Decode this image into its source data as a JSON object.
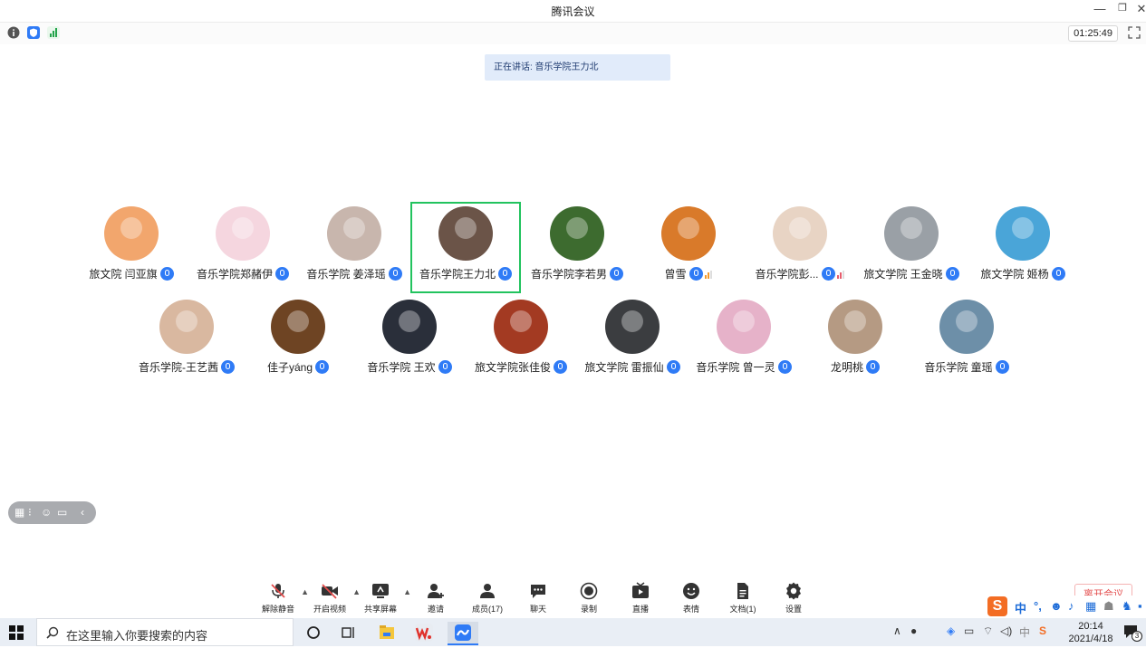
{
  "window": {
    "title": "腾讯会议"
  },
  "status": {
    "timer": "01:25:49"
  },
  "speaking": {
    "text": "正在讲话: 音乐学院王力北"
  },
  "participants": [
    {
      "name": "旅文院 闫亚旗",
      "bg": "#f2a66d"
    },
    {
      "name": "音乐学院郑赭伊",
      "bg": "#f5d6df"
    },
    {
      "name": "音乐学院 姜泽瑶",
      "bg": "#c8b6ad"
    },
    {
      "name": "音乐学院王力北",
      "bg": "#6b5448"
    },
    {
      "name": "音乐学院李若男",
      "bg": "#3d6b2f"
    },
    {
      "name": "曾雪",
      "bg": "#d97a2a"
    },
    {
      "name": "音乐学院彭...",
      "bg": "#e8d4c4"
    },
    {
      "name": "旅文学院 王金晓",
      "bg": "#9aa0a6"
    },
    {
      "name": "旅文学院 姬杨",
      "bg": "#4aa5d8"
    },
    {
      "name": "音乐学院-王艺茜",
      "bg": "#d9b8a0"
    },
    {
      "name": "佳子yáng",
      "bg": "#6e4423"
    },
    {
      "name": "音乐学院 王欢",
      "bg": "#2a2f3a"
    },
    {
      "name": "旅文学院张佳俊",
      "bg": "#a33a22"
    },
    {
      "name": "旅文学院 雷振仙",
      "bg": "#3b3d40"
    },
    {
      "name": "音乐学院 曾一灵",
      "bg": "#e6b2c9"
    },
    {
      "name": "龙明桃",
      "bg": "#b59a83"
    },
    {
      "name": "音乐学院 童瑶",
      "bg": "#6d8fa8"
    }
  ],
  "toolbar": {
    "mute": "解除静音",
    "video": "开启视频",
    "share": "共享屏幕",
    "invite": "邀请",
    "members": "成员(17)",
    "chat": "聊天",
    "record": "录制",
    "live": "直播",
    "emoji": "表情",
    "docs": "文档(1)",
    "settings": "设置",
    "leave": "离开会议"
  },
  "ime": {
    "lang": "中"
  },
  "taskbar": {
    "search_placeholder": "在这里输入你要搜索的内容",
    "tray_lang": "中",
    "time": "20:14",
    "date": "2021/4/18",
    "notif_count": "3"
  },
  "colors": {
    "accent": "#2f7bf6",
    "active_border": "#22c35e",
    "banner": "#e1ebfa",
    "leave": "#e34b4b"
  }
}
